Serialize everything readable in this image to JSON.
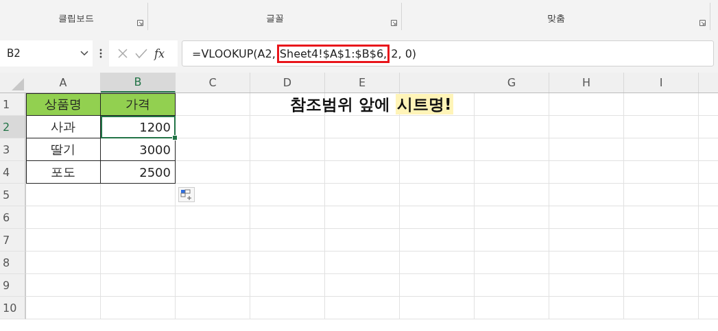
{
  "ribbon": {
    "groups": [
      {
        "label": "클립보드"
      },
      {
        "label": "글꼴"
      },
      {
        "label": "맞춤"
      }
    ]
  },
  "formula_bar": {
    "name_box": "B2",
    "formula_before": "=VLOOKUP(A2,",
    "formula_highlight": "Sheet4!$A$1:$B$6,",
    "formula_after": "2, 0)",
    "function_button": "fx"
  },
  "columns": [
    {
      "label": "A",
      "selected": false
    },
    {
      "label": "B",
      "selected": true
    },
    {
      "label": "C",
      "selected": false
    },
    {
      "label": "D",
      "selected": false
    },
    {
      "label": "E",
      "selected": false
    },
    {
      "selected": false
    },
    {
      "label": "G",
      "selected": false
    },
    {
      "label": "H",
      "selected": false
    },
    {
      "label": "I",
      "selected": false
    }
  ],
  "rows": [
    {
      "label": "1",
      "selected": false,
      "cells": [
        {
          "text": "상품명",
          "kind": "header",
          "selected": false
        },
        {
          "text": "가격",
          "kind": "header",
          "selected": false
        }
      ]
    },
    {
      "label": "2",
      "selected": true,
      "cells": [
        {
          "text": "사과",
          "kind": "text",
          "selected": false
        },
        {
          "text": "1200",
          "kind": "number",
          "selected": true
        }
      ]
    },
    {
      "label": "3",
      "selected": false,
      "cells": [
        {
          "text": "딸기",
          "kind": "text",
          "selected": false
        },
        {
          "text": "3000",
          "kind": "number",
          "selected": false
        }
      ]
    },
    {
      "label": "4",
      "selected": false,
      "cells": [
        {
          "text": "포도",
          "kind": "text",
          "selected": false
        },
        {
          "text": "2500",
          "kind": "number",
          "selected": false
        }
      ]
    },
    {
      "label": "5",
      "selected": false,
      "cells": []
    },
    {
      "label": "6",
      "selected": false,
      "cells": []
    },
    {
      "label": "7",
      "selected": false,
      "cells": []
    },
    {
      "label": "8",
      "selected": false,
      "cells": []
    },
    {
      "label": "9",
      "selected": false,
      "cells": []
    },
    {
      "label": "10",
      "selected": false,
      "cells": []
    }
  ],
  "note": {
    "text": "참조범위 앞에",
    "highlight": "시트명!"
  }
}
